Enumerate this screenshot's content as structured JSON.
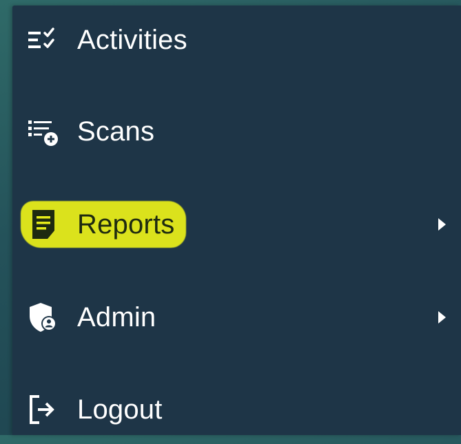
{
  "menu": {
    "items": [
      {
        "label": "Activities",
        "icon": "checklist-icon",
        "has_submenu": false
      },
      {
        "label": "Scans",
        "icon": "scan-list-add-icon",
        "has_submenu": false
      },
      {
        "label": "Reports",
        "icon": "report-document-icon",
        "has_submenu": true,
        "highlighted": true
      },
      {
        "label": "Admin",
        "icon": "admin-shield-icon",
        "has_submenu": true
      },
      {
        "label": "Logout",
        "icon": "logout-icon",
        "has_submenu": false
      }
    ]
  },
  "colors": {
    "panel_background": "#1e3547",
    "text": "#ffffff",
    "highlight": "#e6ec1a"
  }
}
